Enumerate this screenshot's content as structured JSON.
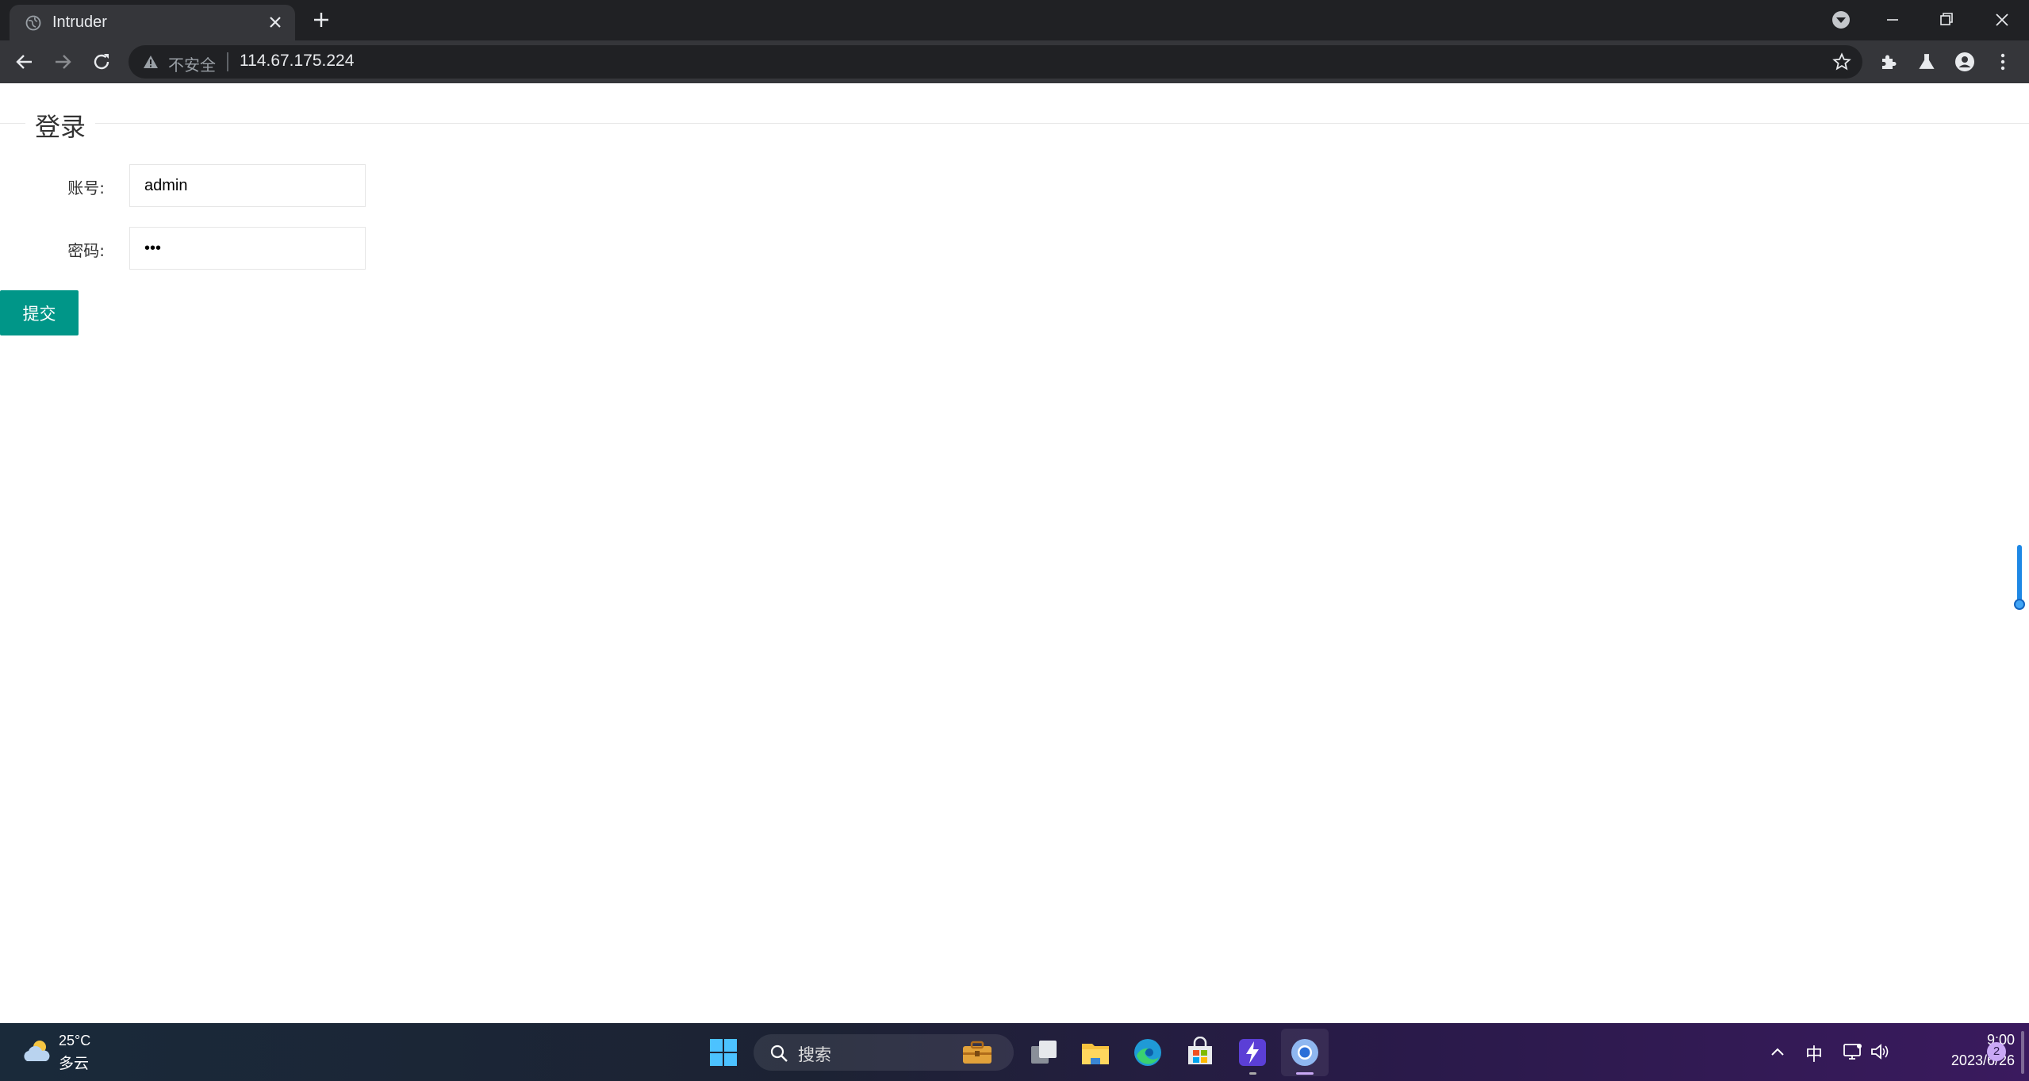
{
  "browser": {
    "tab": {
      "title": "Intruder"
    },
    "address": {
      "security_label": "不安全",
      "url": "114.67.175.224"
    }
  },
  "form": {
    "legend": "登录",
    "fields": [
      {
        "label": "账号:",
        "value": "admin",
        "type": "text"
      },
      {
        "label": "密码:",
        "value": "•••",
        "type": "password"
      }
    ],
    "submit_label": "提交"
  },
  "taskbar": {
    "weather": {
      "temp": "25°C",
      "desc": "多云"
    },
    "search_placeholder": "搜索",
    "tray": {
      "ime": "中"
    },
    "clock": {
      "time": "9:00",
      "date": "2023/6/26"
    },
    "notification_count": "2"
  },
  "colors": {
    "submit_button": "#009688",
    "chrome_dark": "#202124",
    "chrome_toolbar": "#35363a"
  }
}
